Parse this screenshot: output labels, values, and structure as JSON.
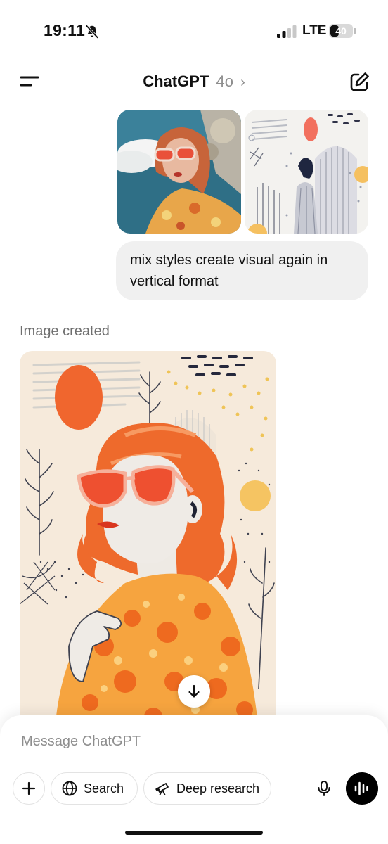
{
  "status_bar": {
    "time": "19:11",
    "network": "LTE",
    "battery": "40",
    "battery_level_percent": 40
  },
  "header": {
    "title": "ChatGPT",
    "model": "4o",
    "chevron": "›"
  },
  "conversation": {
    "user_message": "mix styles create visual again in vertical format",
    "image_label": "Image created"
  },
  "composer": {
    "placeholder": "Message ChatGPT",
    "search_label": "Search",
    "deep_research_label": "Deep research"
  },
  "icons": {
    "menu": "menu-icon",
    "compose": "compose-icon",
    "bell_muted": "bell-slash-icon",
    "scroll_down": "arrow-down-icon",
    "plus": "plus-icon",
    "globe": "globe-icon",
    "telescope": "telescope-icon",
    "mic": "mic-icon",
    "voice": "waveform-icon"
  },
  "colors": {
    "accent_orange": "#f2642e",
    "bubble_bg": "#f0f0f0",
    "muted_text": "#8e8e8e"
  }
}
